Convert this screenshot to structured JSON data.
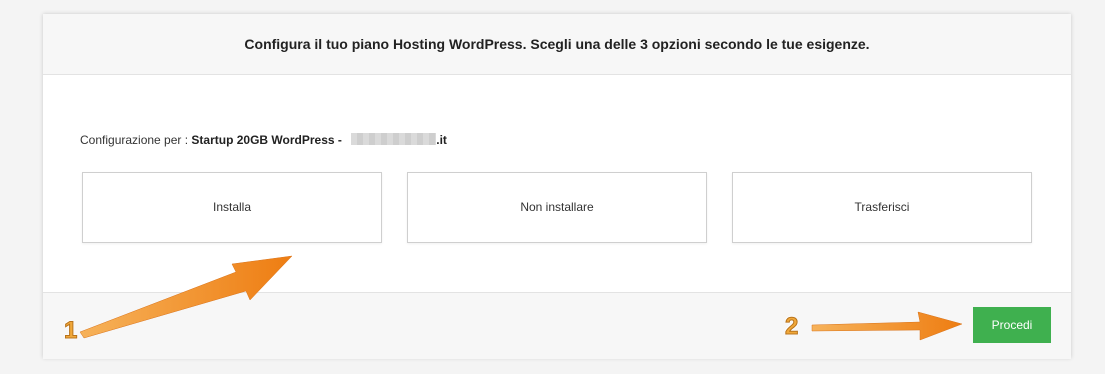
{
  "header": {
    "title": "Configura il tuo piano Hosting WordPress. Scegli una delle 3 opzioni secondo le tue esigenze."
  },
  "config": {
    "label": "Configurazione per : ",
    "plan": "Startup 20GB WordPress -",
    "domain_tld": ".it"
  },
  "options": [
    {
      "label": "Installa"
    },
    {
      "label": "Non installare"
    },
    {
      "label": "Trasferisci"
    }
  ],
  "footer": {
    "proceed_label": "Procedi"
  },
  "annotations": {
    "step_1": "1",
    "step_2": "2"
  },
  "colors": {
    "proceed_button": "#3fb04f",
    "arrow": "#f08a1c"
  }
}
